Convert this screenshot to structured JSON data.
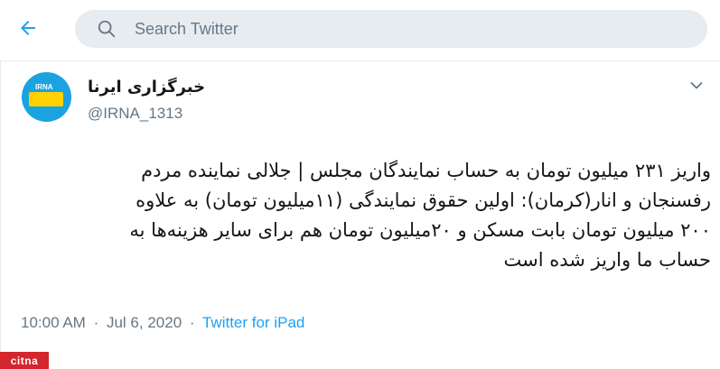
{
  "header": {
    "back_icon": "arrow-left-icon",
    "search_placeholder": "Search Twitter",
    "search_value": "",
    "accent_color": "#1da1f2"
  },
  "tweet": {
    "display_name": "خبرگزاری ایرنا",
    "handle": "@IRNA_1313",
    "avatar_label": "IRNA",
    "avatar_word": "ایرنا",
    "text_lines": [
      "واریز ۲۳۱ میلیون تومان به حساب نمایندگان مجلس | جلالی نماینده مردم",
      "رفسنجان و انار(کرمان): اولین حقوق نمایندگی (۱۱میلیون تومان) به علاوه",
      "۲۰۰ میلیون تومان بابت مسکن و ۲۰میلیون تومان هم برای سایر هزینه‌ها به",
      "حساب ما واریز شده است"
    ],
    "time": "10:00 AM",
    "date": "Jul 6, 2020",
    "separator": "·",
    "source": "Twitter for iPad"
  },
  "watermark": {
    "text": "citna"
  }
}
